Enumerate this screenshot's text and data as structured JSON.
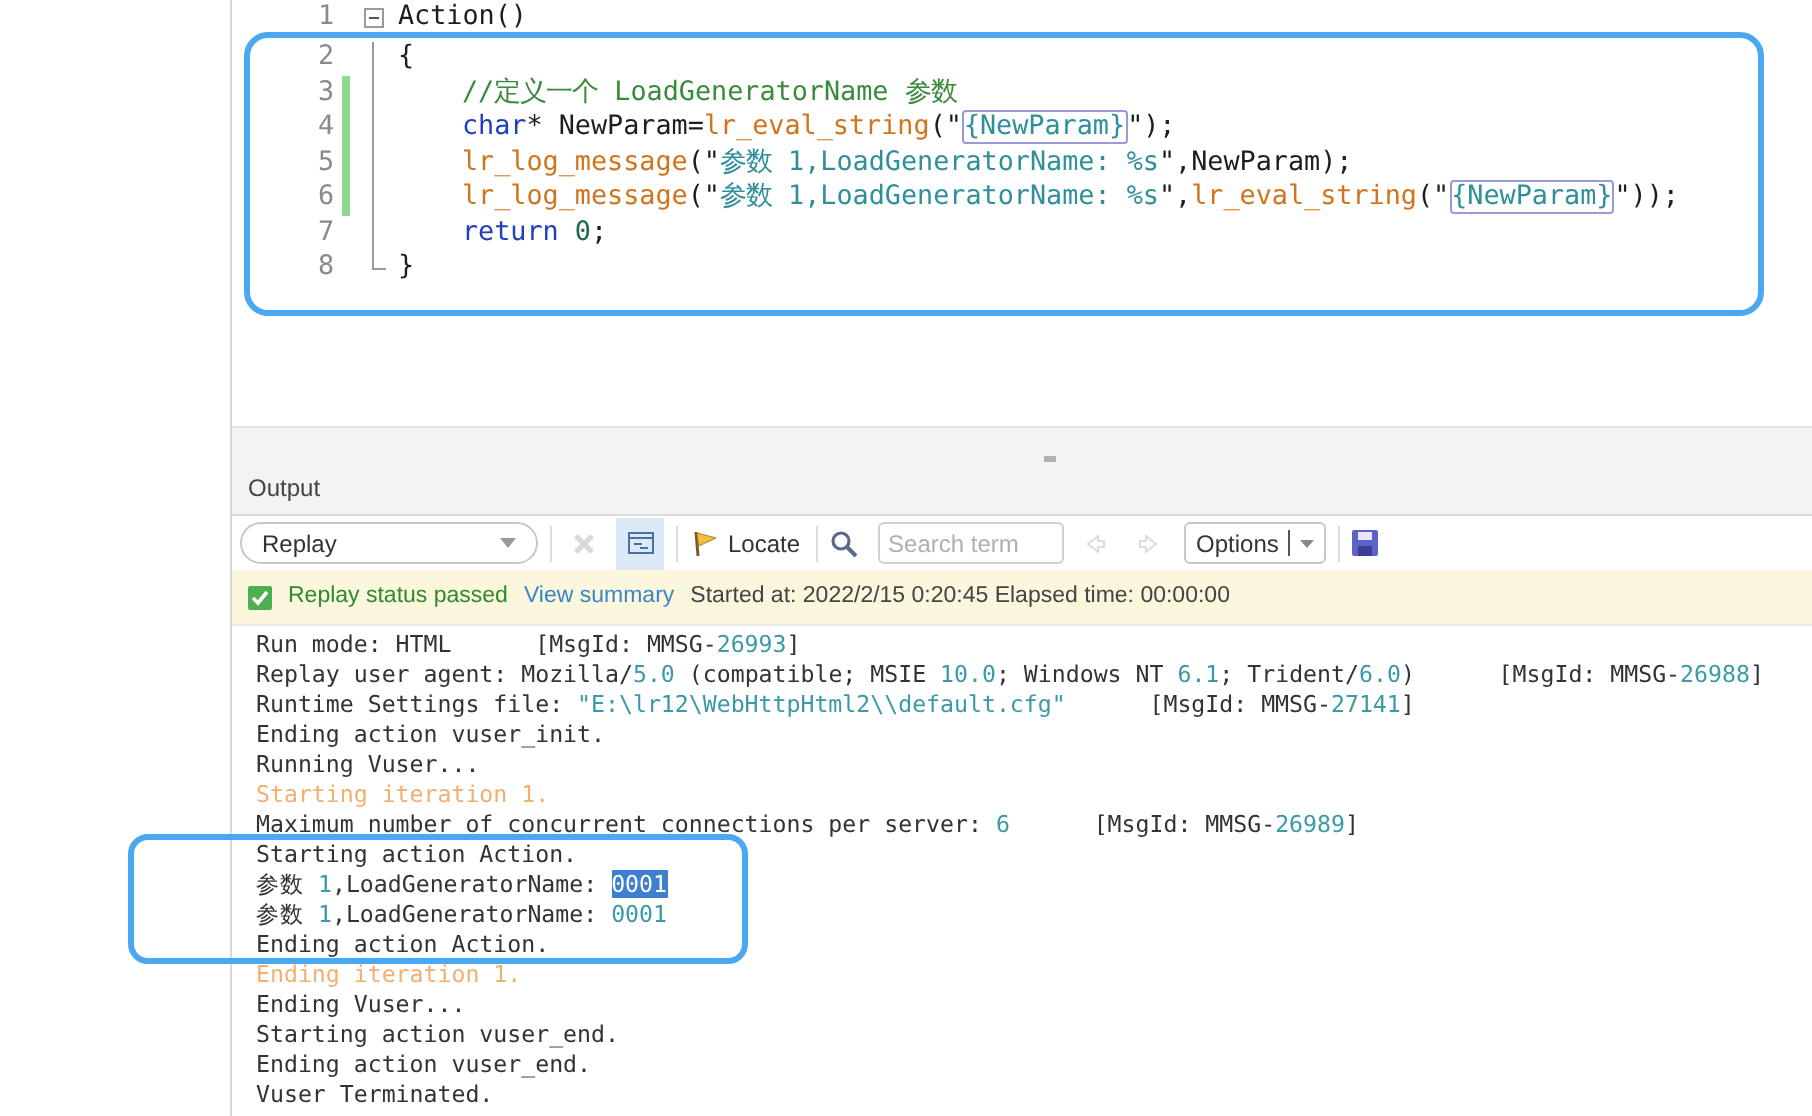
{
  "editor": {
    "lines": [
      {
        "number": "1",
        "fold_start": true,
        "fold_end": false,
        "indent": false,
        "changed": false,
        "tokens": [
          {
            "text": "Action()",
            "kind": "plain"
          }
        ]
      },
      {
        "number": "2",
        "fold_start": false,
        "fold_end": false,
        "indent": false,
        "changed": false,
        "tokens": [
          {
            "text": "{",
            "kind": "plain"
          }
        ]
      },
      {
        "number": "3",
        "fold_start": false,
        "fold_end": false,
        "indent": true,
        "changed": true,
        "tokens": [
          {
            "text": "//定义一个 LoadGeneratorName 参数",
            "kind": "comment"
          }
        ]
      },
      {
        "number": "4",
        "fold_start": false,
        "fold_end": false,
        "indent": true,
        "changed": true,
        "tokens": [
          {
            "text": "char",
            "kind": "keyword"
          },
          {
            "text": "* NewParam=",
            "kind": "plain"
          },
          {
            "text": "lr_eval_string",
            "kind": "func"
          },
          {
            "text": "(\"",
            "kind": "plain"
          },
          {
            "text": "{NewParam}",
            "kind": "param"
          },
          {
            "text": "\");",
            "kind": "plain"
          }
        ]
      },
      {
        "number": "5",
        "fold_start": false,
        "fold_end": false,
        "indent": true,
        "changed": true,
        "tokens": [
          {
            "text": "lr_log_message",
            "kind": "func"
          },
          {
            "text": "(\"",
            "kind": "plain"
          },
          {
            "text": "参数 1,LoadGeneratorName: %s",
            "kind": "string"
          },
          {
            "text": "\",NewParam);",
            "kind": "plain"
          }
        ]
      },
      {
        "number": "6",
        "fold_start": false,
        "fold_end": false,
        "indent": true,
        "changed": true,
        "tokens": [
          {
            "text": "lr_log_message",
            "kind": "func"
          },
          {
            "text": "(\"",
            "kind": "plain"
          },
          {
            "text": "参数 1,LoadGeneratorName: %s",
            "kind": "string"
          },
          {
            "text": "\",",
            "kind": "plain"
          },
          {
            "text": "lr_eval_string",
            "kind": "func"
          },
          {
            "text": "(\"",
            "kind": "plain"
          },
          {
            "text": "{NewParam}",
            "kind": "param"
          },
          {
            "text": "\"));",
            "kind": "plain"
          }
        ]
      },
      {
        "number": "7",
        "fold_start": false,
        "fold_end": false,
        "indent": true,
        "changed": false,
        "tokens": [
          {
            "text": "return",
            "kind": "keyword"
          },
          {
            "text": " 0",
            "kind": "number"
          },
          {
            "text": ";",
            "kind": "plain"
          }
        ]
      },
      {
        "number": "8",
        "fold_start": false,
        "fold_end": true,
        "indent": false,
        "changed": false,
        "tokens": [
          {
            "text": "}",
            "kind": "plain"
          }
        ]
      }
    ]
  },
  "output": {
    "title": "Output",
    "toolbar": {
      "mode": "Replay",
      "clear_disabled": true,
      "view_selected": true,
      "locate": "Locate",
      "search_placeholder": "Search term",
      "nav_disabled": true,
      "options": "Options"
    },
    "status": {
      "result": "Replay status passed",
      "passed": true,
      "link": "View summary",
      "info": "Started at: 2022/2/15 0:20:45 Elapsed time: 00:00:00"
    },
    "log": [
      {
        "tokens": [
          {
            "text": "Run mode: HTML      [MsgId: MMSG-",
            "kind": "plain"
          },
          {
            "text": "26993",
            "kind": "number"
          },
          {
            "text": "]",
            "kind": "plain"
          }
        ]
      },
      {
        "tokens": [
          {
            "text": "Replay user agent: Mozilla/",
            "kind": "plain"
          },
          {
            "text": "5.0",
            "kind": "number"
          },
          {
            "text": " (compatible; MSIE ",
            "kind": "plain"
          },
          {
            "text": "10.0",
            "kind": "number"
          },
          {
            "text": "; Windows NT ",
            "kind": "plain"
          },
          {
            "text": "6.1",
            "kind": "number"
          },
          {
            "text": "; Trident/",
            "kind": "plain"
          },
          {
            "text": "6.0",
            "kind": "number"
          },
          {
            "text": ")      [MsgId: MMSG-",
            "kind": "plain"
          },
          {
            "text": "26988",
            "kind": "number"
          },
          {
            "text": "]",
            "kind": "plain"
          }
        ]
      },
      {
        "tokens": [
          {
            "text": "Runtime Settings file: ",
            "kind": "plain"
          },
          {
            "text": "\"E:\\lr12\\WebHttpHtml2\\\\default.cfg\"",
            "kind": "string"
          },
          {
            "text": "      [MsgId: MMSG-",
            "kind": "plain"
          },
          {
            "text": "27141",
            "kind": "number"
          },
          {
            "text": "]",
            "kind": "plain"
          }
        ]
      },
      {
        "tokens": [
          {
            "text": "Ending action vuser_init.",
            "kind": "plain"
          }
        ]
      },
      {
        "tokens": [
          {
            "text": "Running Vuser...",
            "kind": "plain"
          }
        ]
      },
      {
        "tokens": [
          {
            "text": "Starting iteration 1.",
            "kind": "iteration"
          }
        ]
      },
      {
        "tokens": [
          {
            "text": "Maximum number of concurrent connections per server: ",
            "kind": "plain"
          },
          {
            "text": "6",
            "kind": "number"
          },
          {
            "text": "      [MsgId: MMSG-",
            "kind": "plain"
          },
          {
            "text": "26989",
            "kind": "number"
          },
          {
            "text": "]",
            "kind": "plain"
          }
        ]
      },
      {
        "tokens": [
          {
            "text": "Starting action Action.",
            "kind": "plain"
          }
        ]
      },
      {
        "tokens": [
          {
            "text": "参数 ",
            "kind": "plain"
          },
          {
            "text": "1",
            "kind": "number"
          },
          {
            "text": ",LoadGeneratorName: ",
            "kind": "plain"
          },
          {
            "text": "0001",
            "kind": "selected"
          }
        ]
      },
      {
        "tokens": [
          {
            "text": "参数 ",
            "kind": "plain"
          },
          {
            "text": "1",
            "kind": "number"
          },
          {
            "text": ",LoadGeneratorName: ",
            "kind": "plain"
          },
          {
            "text": "0001",
            "kind": "number"
          }
        ]
      },
      {
        "tokens": [
          {
            "text": "Ending action Action.",
            "kind": "plain"
          }
        ]
      },
      {
        "tokens": [
          {
            "text": "Ending iteration 1.",
            "kind": "iteration"
          }
        ]
      },
      {
        "tokens": [
          {
            "text": "Ending Vuser...",
            "kind": "plain"
          }
        ]
      },
      {
        "tokens": [
          {
            "text": "Starting action vuser_end.",
            "kind": "plain"
          }
        ]
      },
      {
        "tokens": [
          {
            "text": "Ending action vuser_end.",
            "kind": "plain"
          }
        ]
      },
      {
        "tokens": [
          {
            "text": "Vuser Terminated.",
            "kind": "plain"
          }
        ]
      }
    ]
  }
}
